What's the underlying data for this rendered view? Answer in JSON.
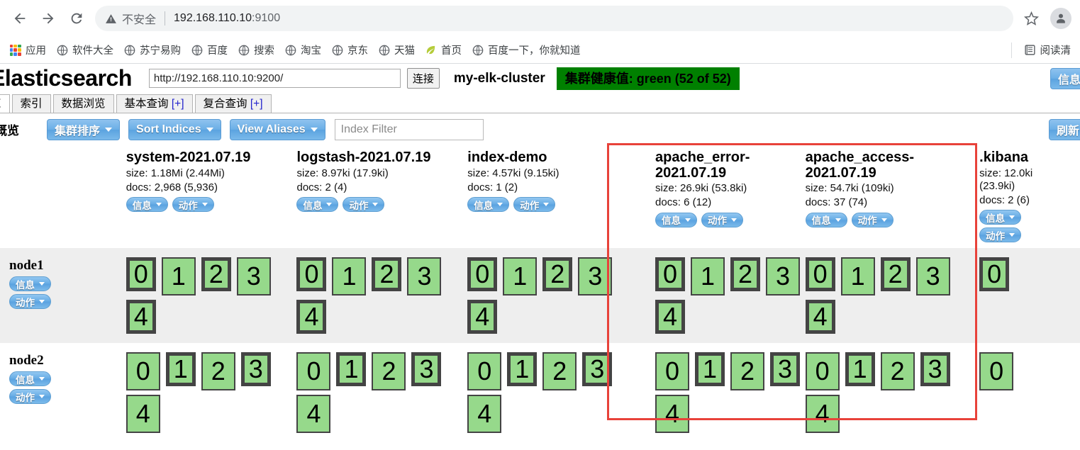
{
  "browser": {
    "back_icon": "back-arrow-icon",
    "forward_icon": "forward-arrow-icon",
    "reload_icon": "reload-icon",
    "security_label": "不安全",
    "url": "192.168.110.10:9100",
    "url_host": "192.168.110.10",
    "url_port": ":9100",
    "star_icon": "bookmark-star-icon",
    "avatar_icon": "profile-avatar-icon",
    "bookmarks": [
      {
        "label": "应用",
        "icon": "apps-grid-icon"
      },
      {
        "label": "软件大全",
        "icon": "globe-icon"
      },
      {
        "label": "苏宁易购",
        "icon": "globe-icon"
      },
      {
        "label": "百度",
        "icon": "globe-icon"
      },
      {
        "label": "搜索",
        "icon": "globe-icon"
      },
      {
        "label": "淘宝",
        "icon": "globe-icon"
      },
      {
        "label": "京东",
        "icon": "globe-icon"
      },
      {
        "label": "天猫",
        "icon": "globe-icon"
      },
      {
        "label": "首页",
        "icon": "leaf-icon"
      },
      {
        "label": "百度一下，你就知道",
        "icon": "globe-icon"
      }
    ],
    "reading_list": {
      "label": "阅读清",
      "icon": "reading-list-icon"
    }
  },
  "es_head": {
    "brand": "Elasticsearch",
    "url_value": "http://192.168.110.10:9200/",
    "connect_label": "连接",
    "cluster_name": "my-elk-cluster",
    "health_badge": "集群健康值: green (52 of 52)",
    "header_info_label": "信息",
    "tabs": [
      {
        "label": "览",
        "active": true
      },
      {
        "label": "索引",
        "active": false
      },
      {
        "label": "数据浏览",
        "active": false
      },
      {
        "label": "基本查询",
        "plus": "[+]",
        "active": false
      },
      {
        "label": "复合查询",
        "plus": "[+]",
        "active": false
      }
    ],
    "toolbar": {
      "section_title": "群概览",
      "cluster_sort_label": "集群排序",
      "sort_indices_label": "Sort Indices",
      "view_aliases_label": "View Aliases",
      "index_filter_placeholder": "Index Filter",
      "refresh_label": "刷新"
    },
    "common": {
      "info_label": "信息",
      "action_label": "动作"
    },
    "indices": [
      {
        "name": "system-2021.07.19",
        "size": "size: 1.18Mi (2.44Mi)",
        "docs": "docs: 2,968 (5,936)",
        "shards_node1": [
          "0",
          "1",
          "2",
          "3",
          "4"
        ],
        "shards_node2": [
          "0",
          "1",
          "2",
          "3",
          "4"
        ],
        "primaries_node1": [
          true,
          false,
          true,
          false,
          true
        ],
        "primaries_node2": [
          false,
          true,
          false,
          true,
          false
        ],
        "stacked_buttons": false
      },
      {
        "name": "logstash-2021.07.19",
        "size": "size: 8.97ki (17.9ki)",
        "docs": "docs: 2 (4)",
        "shards_node1": [
          "0",
          "1",
          "2",
          "3",
          "4"
        ],
        "shards_node2": [
          "0",
          "1",
          "2",
          "3",
          "4"
        ],
        "primaries_node1": [
          true,
          false,
          true,
          false,
          true
        ],
        "primaries_node2": [
          false,
          true,
          false,
          true,
          false
        ],
        "stacked_buttons": false
      },
      {
        "name": "index-demo",
        "size": "size: 4.57ki (9.15ki)",
        "docs": "docs: 1 (2)",
        "shards_node1": [
          "0",
          "1",
          "2",
          "3",
          "4"
        ],
        "shards_node2": [
          "0",
          "1",
          "2",
          "3",
          "4"
        ],
        "primaries_node1": [
          true,
          false,
          true,
          false,
          true
        ],
        "primaries_node2": [
          false,
          true,
          false,
          true,
          false
        ],
        "stacked_buttons": false
      },
      {
        "name": "apache_error-2021.07.19",
        "size": "size: 26.9ki (53.8ki)",
        "docs": "docs: 6 (12)",
        "shards_node1": [
          "0",
          "1",
          "2",
          "3",
          "4"
        ],
        "shards_node2": [
          "0",
          "1",
          "2",
          "3",
          "4"
        ],
        "primaries_node1": [
          true,
          false,
          true,
          false,
          true
        ],
        "primaries_node2": [
          false,
          true,
          false,
          true,
          false
        ],
        "stacked_buttons": false,
        "highlighted": true
      },
      {
        "name": "apache_access-2021.07.19",
        "size": "size: 54.7ki (109ki)",
        "docs": "docs: 37 (74)",
        "shards_node1": [
          "0",
          "1",
          "2",
          "3",
          "4"
        ],
        "shards_node2": [
          "0",
          "1",
          "2",
          "3",
          "4"
        ],
        "primaries_node1": [
          true,
          false,
          true,
          false,
          true
        ],
        "primaries_node2": [
          false,
          true,
          false,
          true,
          false
        ],
        "stacked_buttons": false,
        "highlighted": true
      },
      {
        "name": ".kibana",
        "size": "size: 12.0ki (23.9ki)",
        "docs": "docs: 2 (6)",
        "shards_node1": [
          "0"
        ],
        "shards_node2": [
          "0"
        ],
        "primaries_node1": [
          true
        ],
        "primaries_node2": [
          false
        ],
        "stacked_buttons": true
      }
    ],
    "nodes": [
      {
        "name": "node1",
        "marker": "dot-marker",
        "row_shade": "gray"
      },
      {
        "name": "node2",
        "marker": "star-marker",
        "row_shade": "white"
      }
    ],
    "annotation": {
      "color": "#e8423a"
    }
  }
}
